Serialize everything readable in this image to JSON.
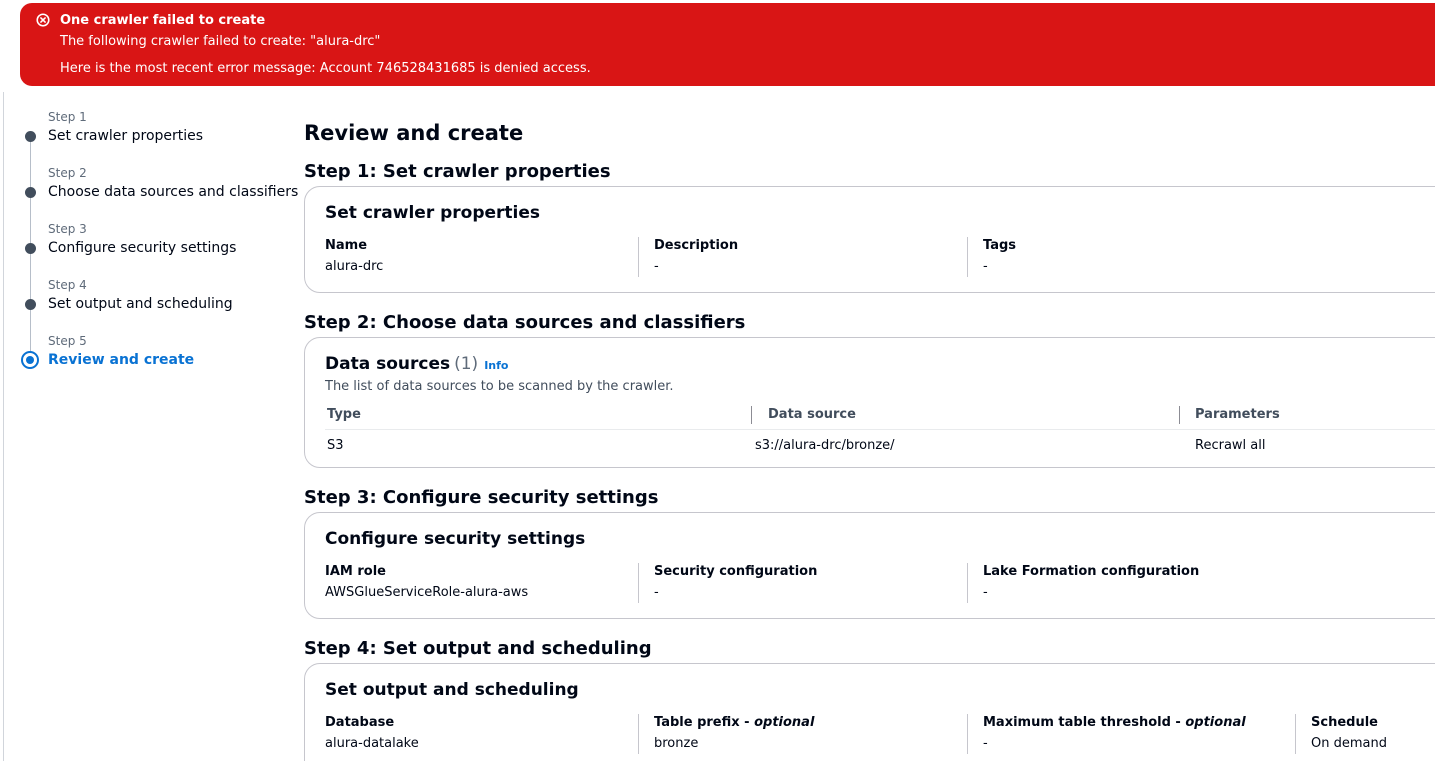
{
  "flash": {
    "icon": "error-circle-x-icon",
    "color": "#d91515",
    "title": "One crawler failed to create",
    "line1": "The following crawler failed to create: \"alura-drc\"",
    "line2": "Here is the most recent error message: Account 746528431685 is denied access."
  },
  "wizard": {
    "steps": [
      {
        "step": "Step 1",
        "label": "Set crawler properties"
      },
      {
        "step": "Step 2",
        "label": "Choose data sources and classifiers"
      },
      {
        "step": "Step 3",
        "label": "Configure security settings"
      },
      {
        "step": "Step 4",
        "label": "Set output and scheduling"
      },
      {
        "step": "Step 5",
        "label": "Review and create"
      }
    ],
    "active_step": 5,
    "active_color": "#0972d3"
  },
  "page_title": "Review and create",
  "step1": {
    "heading": "Step 1: Set crawler properties",
    "card_title": "Set crawler properties",
    "fields": [
      {
        "key": "Name",
        "value": "alura-drc"
      },
      {
        "key": "Description",
        "value": "-"
      },
      {
        "key": "Tags",
        "value": "-"
      }
    ]
  },
  "step2": {
    "heading": "Step 2: Choose data sources and classifiers",
    "table_title": "Data sources",
    "count": "(1)",
    "info": "Info",
    "description": "The list of data sources to be scanned by the crawler.",
    "columns": [
      "Type",
      "Data source",
      "Parameters"
    ],
    "rows": [
      {
        "type": "S3",
        "source": "s3://alura-drc/bronze/",
        "params": "Recrawl all"
      }
    ]
  },
  "step3": {
    "heading": "Step 3: Configure security settings",
    "card_title": "Configure security settings",
    "fields": [
      {
        "key": "IAM role",
        "value": "AWSGlueServiceRole-alura-aws"
      },
      {
        "key": "Security configuration",
        "value": "-"
      },
      {
        "key": "Lake Formation configuration",
        "value": "-"
      }
    ]
  },
  "step4": {
    "heading": "Step 4: Set output and scheduling",
    "card_title": "Set output and scheduling",
    "fields": [
      {
        "key": "Database",
        "optional": "",
        "value": "alura-datalake"
      },
      {
        "key": "Table prefix - ",
        "optional": "optional",
        "value": "bronze"
      },
      {
        "key": "Maximum table threshold - ",
        "optional": "optional",
        "value": "-"
      },
      {
        "key": "Schedule",
        "optional": "",
        "value": "On demand"
      }
    ]
  }
}
